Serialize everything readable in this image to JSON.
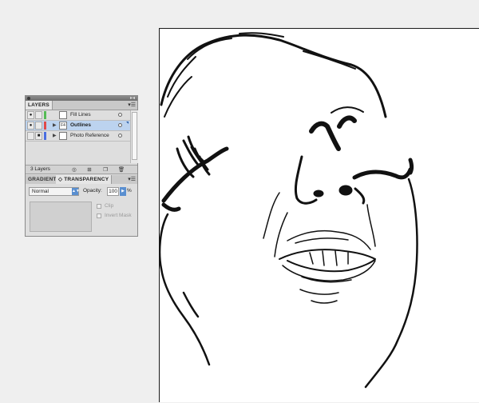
{
  "layers_panel": {
    "tab_label": "LAYERS",
    "menu_icon": "panel-menu-icon",
    "layers": [
      {
        "name": "Fill Lines",
        "visible": true,
        "locked": false,
        "color": "#55bb55",
        "thumb": "",
        "selected": false
      },
      {
        "name": "Outlines",
        "visible": true,
        "locked": false,
        "color": "#e04a4a",
        "thumb": "F4",
        "selected": true
      },
      {
        "name": "Photo Reference",
        "visible": false,
        "locked": true,
        "color": "#4a6ee0",
        "thumb": "",
        "selected": false
      }
    ],
    "layer_count": "3 Layers",
    "footer_icons": [
      "make-clipping-mask-icon",
      "create-sublayer-icon",
      "create-layer-icon",
      "delete-layer-icon"
    ]
  },
  "transparency_panel": {
    "tabs": [
      "GRADIENT",
      "TRANSPARENCY"
    ],
    "blend_mode": "Normal",
    "opacity_label": "Opacity:",
    "opacity_value": "100",
    "opacity_unit": "%",
    "clip_label": "Clip",
    "invert_mask_label": "Invert Mask"
  },
  "colors": {
    "selection": "#bcd3ef",
    "accent": "#5a8fd0"
  }
}
